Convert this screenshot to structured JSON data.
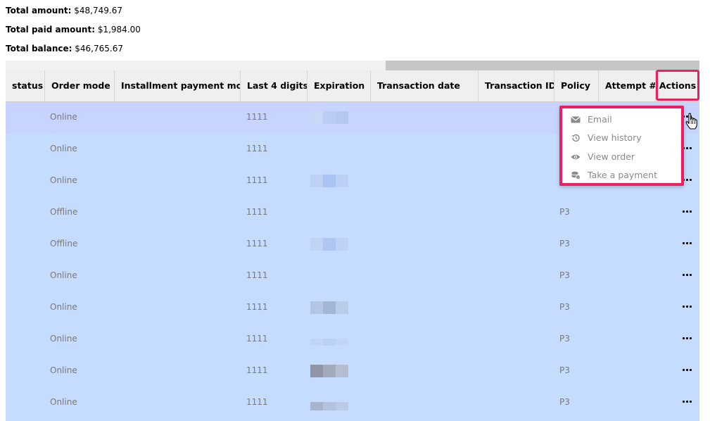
{
  "summary": {
    "total_amount_label": "Total amount:",
    "total_amount_value": "$48,749.67",
    "total_paid_label": "Total paid amount:",
    "total_paid_value": "$1,984.00",
    "total_balance_label": "Total balance:",
    "total_balance_value": "$46,765.67"
  },
  "table": {
    "columns": [
      "status",
      "Order mode",
      "Installment payment mode",
      "Last 4 digits",
      "Expiration",
      "Transaction date",
      "Transaction ID",
      "Policy",
      "Attempt #",
      "Actions"
    ],
    "rows": [
      {
        "order_mode": "Online",
        "last4": "1111",
        "policy": ""
      },
      {
        "order_mode": "Online",
        "last4": "1111",
        "policy": ""
      },
      {
        "order_mode": "Online",
        "last4": "1111",
        "policy": ""
      },
      {
        "order_mode": "Offline",
        "last4": "1111",
        "policy": "P3"
      },
      {
        "order_mode": "Offline",
        "last4": "1111",
        "policy": "P3"
      },
      {
        "order_mode": "Online",
        "last4": "1111",
        "policy": "P3"
      },
      {
        "order_mode": "Online",
        "last4": "1111",
        "policy": "P3"
      },
      {
        "order_mode": "Online",
        "last4": "1111",
        "policy": "P3"
      },
      {
        "order_mode": "Online",
        "last4": "1111",
        "policy": "P3"
      },
      {
        "order_mode": "Online",
        "last4": "1111",
        "policy": "P3"
      }
    ]
  },
  "actions_menu": {
    "items": [
      {
        "label": "Email",
        "icon": "envelope-icon"
      },
      {
        "label": "View history",
        "icon": "history-icon"
      },
      {
        "label": "View order",
        "icon": "eye-icon"
      },
      {
        "label": "Take a payment",
        "icon": "coins-icon"
      }
    ]
  },
  "colors": {
    "row_bg": "#c5dcff",
    "row_hover": "#c6d4ff",
    "header_bg": "#efefef",
    "highlight": "#f21d5e"
  }
}
